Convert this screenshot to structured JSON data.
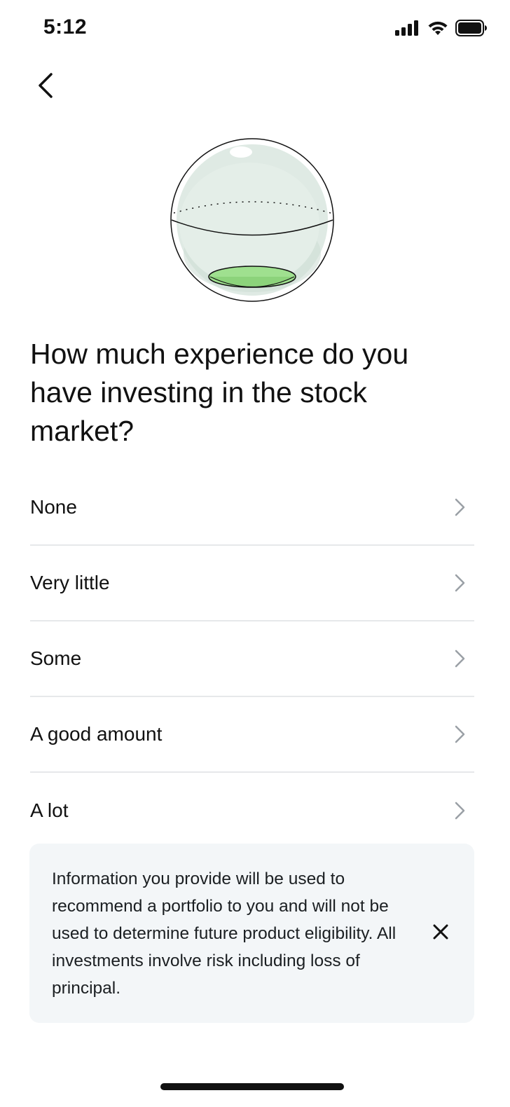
{
  "status_bar": {
    "time": "5:12",
    "icons": [
      "cellular-signal-icon",
      "wifi-icon",
      "battery-icon"
    ]
  },
  "navigation": {
    "back_icon": "chevron-left-icon"
  },
  "hero": {
    "icon": "glass-sphere-illustration",
    "accent_color": "#9fe08f"
  },
  "question": {
    "title": "How much experience do you have investing in the stock market?"
  },
  "options": [
    {
      "label": "None"
    },
    {
      "label": "Very little"
    },
    {
      "label": "Some"
    },
    {
      "label": "A good amount"
    },
    {
      "label": "A lot"
    }
  ],
  "disclaimer": {
    "text": "Information you provide will be used to recommend a portfolio to you and will not be used to determine future product eligibility. All investments involve risk including loss of principal.",
    "close_icon": "close-icon"
  },
  "colors": {
    "background": "#ffffff",
    "text": "#111111",
    "divider": "#e6e8ea",
    "chevron": "#9aa0a6",
    "disclaimer_background": "#f3f6f8"
  }
}
